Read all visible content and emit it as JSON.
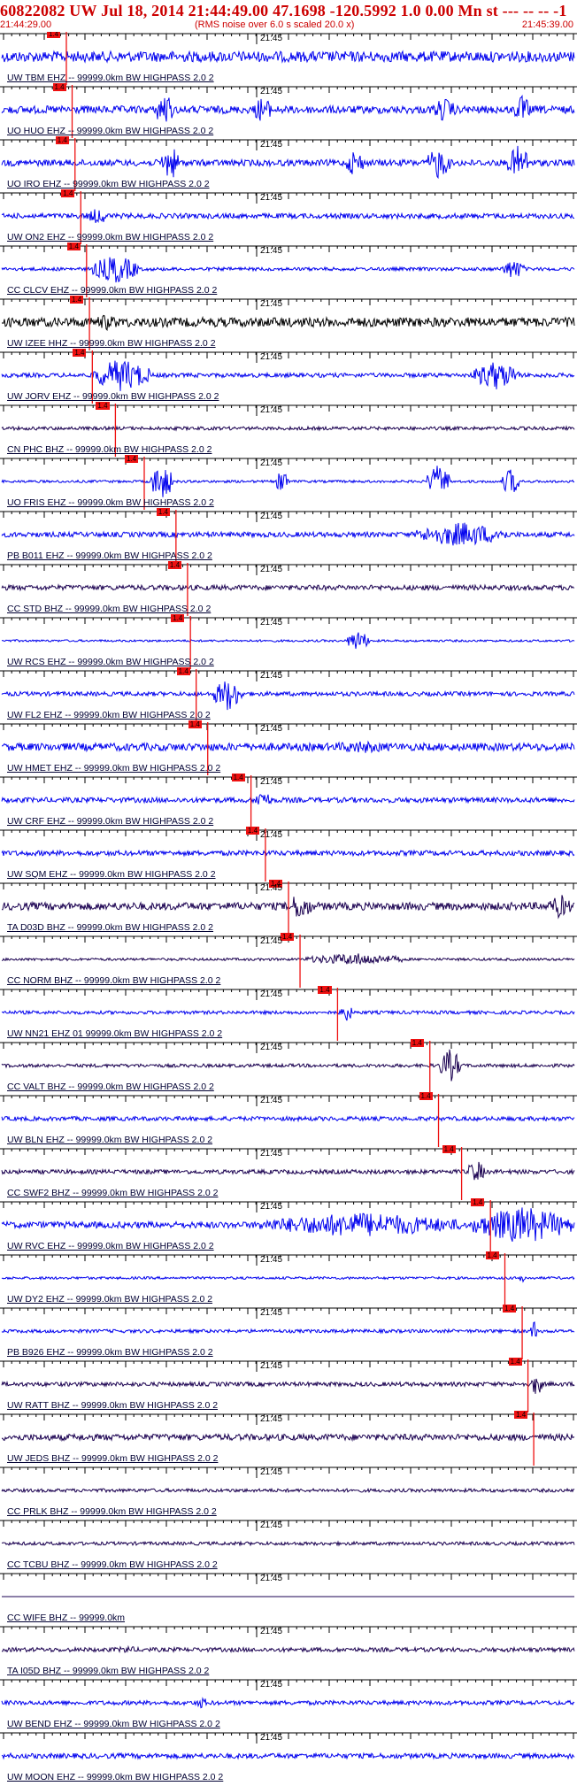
{
  "header": {
    "title": "60822082 UW Jul 18, 2014 21:44:49.00   47.1698 -120.5992  1.0 0.00 Mn st --- -- --  -1",
    "start_time": "21:44:29.00",
    "note": "(RMS noise over 6.0 s scaled 20.0 x)",
    "end_time": "21:45:39.00"
  },
  "colors": {
    "header_text": "#cc0000",
    "trace_blue": "#0000ee",
    "trace_dark": "#1a0050",
    "trace_black": "#000000",
    "pick_red": "#ee1111"
  },
  "minute_label": "21:45",
  "pick_label": "1.4",
  "traces": [
    {
      "label": "UW TBM EHZ -- 99999.0km BW  HIGHPASS  2.0  2",
      "color": "blue",
      "amp": 0.25,
      "pick": 0.115,
      "bursts": []
    },
    {
      "label": "UO HUO EHZ -- 99999.0km BW  HIGHPASS  2.0  2",
      "color": "blue",
      "amp": 0.18,
      "pick": 0.125,
      "bursts": [
        [
          0.27,
          0.3,
          0.9
        ],
        [
          0.44,
          0.47,
          0.7
        ],
        [
          0.75,
          0.79,
          0.6
        ],
        [
          0.89,
          0.92,
          0.7
        ]
      ]
    },
    {
      "label": "UO IRO EHZ -- 99999.0km BW  HIGHPASS  2.0  2",
      "color": "blue",
      "amp": 0.15,
      "pick": 0.13,
      "bursts": [
        [
          0.28,
          0.31,
          0.9
        ],
        [
          0.6,
          0.63,
          0.7
        ],
        [
          0.74,
          0.78,
          0.8
        ],
        [
          0.88,
          0.92,
          0.9
        ]
      ]
    },
    {
      "label": "UW ON2 EHZ -- 99999.0km BW  HIGHPASS  2.0  2",
      "color": "blue",
      "amp": 0.12,
      "pick": 0.14,
      "bursts": [
        [
          0.15,
          0.19,
          0.4
        ]
      ]
    },
    {
      "label": "CC CLCV EHZ -- 99999.0km BW  HIGHPASS  2.0  2",
      "color": "blue",
      "amp": 0.08,
      "pick": 0.15,
      "bursts": [
        [
          0.16,
          0.24,
          0.7
        ],
        [
          0.87,
          0.91,
          0.5
        ]
      ]
    },
    {
      "label": "UW IZEE HHZ -- 99999.0km BW  HIGHPASS  2.0  2",
      "color": "black",
      "amp": 0.22,
      "pick": 0.155,
      "bursts": [
        [
          0.16,
          0.21,
          0.4
        ]
      ]
    },
    {
      "label": "UW JORV EHZ -- 99999.0km BW  HIGHPASS  2.0  2",
      "color": "blue",
      "amp": 0.1,
      "pick": 0.16,
      "bursts": [
        [
          0.16,
          0.26,
          0.8
        ],
        [
          0.82,
          0.9,
          0.7
        ]
      ]
    },
    {
      "label": "CN PHC BHZ -- 99999.0km BW  HIGHPASS  2.0  2",
      "color": "dark",
      "amp": 0.08,
      "pick": 0.2,
      "bursts": []
    },
    {
      "label": "UO FRIS EHZ -- 99999.0km BW  HIGHPASS  2.0  2",
      "color": "blue",
      "amp": 0.06,
      "pick": 0.25,
      "bursts": [
        [
          0.26,
          0.3,
          0.9
        ],
        [
          0.48,
          0.5,
          0.7
        ],
        [
          0.74,
          0.78,
          0.8
        ],
        [
          0.87,
          0.9,
          0.7
        ]
      ]
    },
    {
      "label": "PB B011 EHZ -- 99999.0km BW  HIGHPASS  2.0  2",
      "color": "blue",
      "amp": 0.12,
      "pick": 0.305,
      "bursts": [
        [
          0.72,
          0.88,
          0.6
        ]
      ]
    },
    {
      "label": "CC STD BHZ -- 99999.0km BW  HIGHPASS  2.0  2",
      "color": "dark",
      "amp": 0.12,
      "pick": 0.325,
      "bursts": []
    },
    {
      "label": "UW RCS EHZ -- 99999.0km BW  HIGHPASS  2.0  2",
      "color": "blue",
      "amp": 0.05,
      "pick": 0.33,
      "bursts": [
        [
          0.6,
          0.64,
          0.5
        ]
      ]
    },
    {
      "label": "UW FL2 EHZ -- 99999.0km BW  HIGHPASS  2.0  2",
      "color": "blue",
      "amp": 0.1,
      "pick": 0.34,
      "bursts": [
        [
          0.37,
          0.42,
          0.8
        ]
      ]
    },
    {
      "label": "UW HMET EHZ -- 99999.0km BW  HIGHPASS  2.0  2",
      "color": "blue",
      "amp": 0.18,
      "pick": 0.36,
      "bursts": [
        [
          0.55,
          0.7,
          0.3
        ]
      ]
    },
    {
      "label": "UW CRF EHZ -- 99999.0km BW  HIGHPASS  2.0  2",
      "color": "blue",
      "amp": 0.12,
      "pick": 0.435,
      "bursts": [
        [
          0.44,
          0.47,
          0.5
        ]
      ]
    },
    {
      "label": "UW SQM EHZ -- 99999.0km BW  HIGHPASS  2.0  2",
      "color": "blue",
      "amp": 0.12,
      "pick": 0.46,
      "bursts": []
    },
    {
      "label": "TA D03D BHZ -- 99999.0km BW  HIGHPASS  2.0  2",
      "color": "dark",
      "amp": 0.18,
      "pick": 0.5,
      "bursts": [
        [
          0.5,
          0.54,
          0.7
        ],
        [
          0.95,
          0.99,
          0.6
        ]
      ]
    },
    {
      "label": "CC NORM BHZ -- 99999.0km BW  HIGHPASS  2.0  2",
      "color": "dark",
      "amp": 0.06,
      "pick": 0.52,
      "bursts": [
        [
          0.53,
          0.7,
          0.3
        ]
      ]
    },
    {
      "label": "UW NN21 EHZ 01 99999.0km BW  HIGHPASS  2.0  2",
      "color": "blue",
      "amp": 0.08,
      "pick": 0.585,
      "bursts": [
        [
          0.59,
          0.61,
          0.5
        ]
      ]
    },
    {
      "label": "CC VALT BHZ -- 99999.0km BW  HIGHPASS  2.0  2",
      "color": "dark",
      "amp": 0.08,
      "pick": 0.745,
      "bursts": [
        [
          0.76,
          0.8,
          0.8
        ]
      ]
    },
    {
      "label": "UW BLN EHZ -- 99999.0km BW  HIGHPASS  2.0  2",
      "color": "blue",
      "amp": 0.1,
      "pick": 0.76,
      "bursts": []
    },
    {
      "label": "CC SWF2 BHZ -- 99999.0km BW  HIGHPASS  2.0  2",
      "color": "dark",
      "amp": 0.1,
      "pick": 0.8,
      "bursts": [
        [
          0.81,
          0.84,
          0.6
        ]
      ]
    },
    {
      "label": "UW RVC EHZ -- 99999.0km BW  HIGHPASS  2.0  2",
      "color": "blue",
      "amp": 0.15,
      "pick": 0.85,
      "bursts": [
        [
          0.45,
          0.8,
          0.6
        ],
        [
          0.82,
          0.99,
          0.9
        ]
      ]
    },
    {
      "label": "UW DY2 EHZ -- 99999.0km BW  HIGHPASS  2.0  2",
      "color": "blue",
      "amp": 0.06,
      "pick": 0.875,
      "bursts": [
        [
          0.9,
          0.91,
          0.4
        ]
      ]
    },
    {
      "label": "PB B926 EHZ -- 99999.0km BW  HIGHPASS  2.0  2",
      "color": "blue",
      "amp": 0.08,
      "pick": 0.905,
      "bursts": [
        [
          0.92,
          0.93,
          0.6
        ]
      ]
    },
    {
      "label": "UW RATT BHZ -- 99999.0km BW  HIGHPASS  2.0  2",
      "color": "dark",
      "amp": 0.1,
      "pick": 0.915,
      "bursts": [
        [
          0.92,
          0.94,
          0.6
        ]
      ]
    },
    {
      "label": "UW JEDS BHZ -- 99999.0km BW  HIGHPASS  2.0  2",
      "color": "dark",
      "amp": 0.15,
      "pick": 0.925,
      "bursts": []
    },
    {
      "label": "CC PRLK BHZ -- 99999.0km BW  HIGHPASS  2.0  2",
      "color": "dark",
      "amp": 0.08,
      "pick": null,
      "bursts": []
    },
    {
      "label": "CC TCBU BHZ -- 99999.0km BW  HIGHPASS  2.0  2",
      "color": "dark",
      "amp": 0.08,
      "pick": null,
      "bursts": []
    },
    {
      "label": "CC WIFE BHZ -- 99999.0km",
      "color": "dark",
      "amp": 0.0,
      "pick": null,
      "bursts": []
    },
    {
      "label": "TA I05D BHZ -- 99999.0km BW  HIGHPASS  2.0  2",
      "color": "dark",
      "amp": 0.1,
      "pick": null,
      "bursts": [
        [
          0.2,
          0.24,
          0.2
        ]
      ]
    },
    {
      "label": "UW BEND EHZ -- 99999.0km BW  HIGHPASS  2.0  2",
      "color": "blue",
      "amp": 0.1,
      "pick": null,
      "bursts": [
        [
          0.34,
          0.36,
          0.3
        ]
      ]
    },
    {
      "label": "UW MOON EHZ -- 99999.0km BW  HIGHPASS  2.0  2",
      "color": "blue",
      "amp": 0.12,
      "pick": null,
      "bursts": []
    }
  ]
}
